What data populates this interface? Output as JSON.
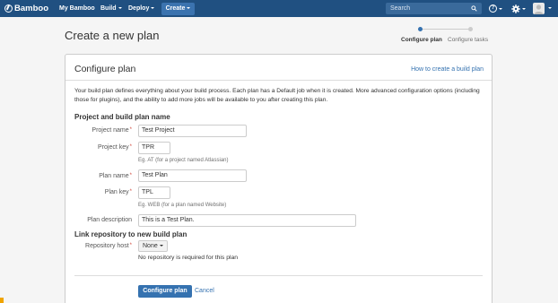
{
  "nav": {
    "logo": "Bamboo",
    "my_bamboo": "My Bamboo",
    "build": "Build",
    "deploy": "Deploy",
    "create": "Create",
    "search_placeholder": "Search",
    "help_icon": "question-circle-icon",
    "settings_icon": "gear-icon"
  },
  "page": {
    "title": "Create a new plan",
    "steps": [
      "Configure plan",
      "Configure tasks"
    ]
  },
  "card": {
    "title": "Configure plan",
    "help_link": "How to create a build plan",
    "description": "Your build plan defines everything about your build process. Each plan has a Default job when it is created. More advanced configuration options (including those for plugins), and the ability to add more jobs will be available to you after creating this plan.",
    "section_project": "Project and build plan name",
    "project_name": {
      "label": "Project name",
      "value": "Test Project"
    },
    "project_key": {
      "label": "Project key",
      "value": "TPR",
      "hint": "Eg. AT (for a project named Atlassian)"
    },
    "plan_name": {
      "label": "Plan name",
      "value": "Test Plan"
    },
    "plan_key": {
      "label": "Plan key",
      "value": "TPL",
      "hint": "Eg. WEB (for a plan named Website)"
    },
    "plan_description": {
      "label": "Plan description",
      "value": "This is a Test Plan."
    },
    "section_repo": "Link repository to new build plan",
    "repo_host": {
      "label": "Repository host",
      "value": "None",
      "note": "No repository is required for this plan"
    },
    "submit": "Configure plan",
    "cancel": "Cancel"
  },
  "colors": {
    "header": "#205081",
    "primary": "#3572b0",
    "required": "#d04437"
  }
}
